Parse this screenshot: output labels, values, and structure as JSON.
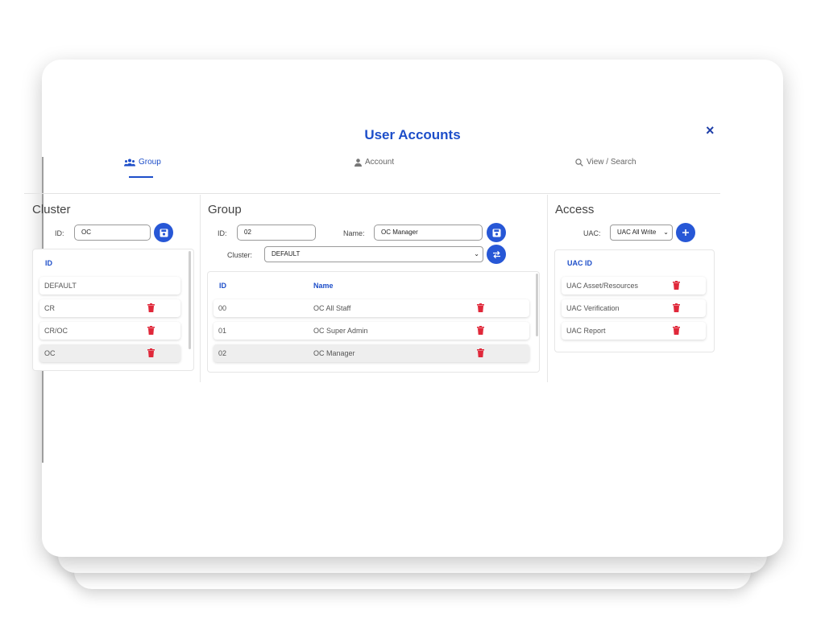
{
  "dialog": {
    "title": "User Accounts",
    "close_symbol": "×"
  },
  "tabs": [
    {
      "label": "Group",
      "icon": "users-icon",
      "active": true
    },
    {
      "label": "Account",
      "icon": "user-icon",
      "active": false
    },
    {
      "label": "View / Search",
      "icon": "search-icon",
      "active": false
    }
  ],
  "cluster": {
    "title": "Cluster",
    "id_label": "ID:",
    "id_value": "OC",
    "header": "ID",
    "rows": [
      "DEFAULT",
      "CR",
      "CR/OC",
      "OC"
    ]
  },
  "group": {
    "title": "Group",
    "id_label": "ID:",
    "id_value": "02",
    "name_label": "Name:",
    "name_value": "OC Manager",
    "cluster_label": "Cluster:",
    "cluster_value": "DEFAULT",
    "headers": {
      "id": "ID",
      "name": "Name"
    },
    "rows": [
      {
        "id": "00",
        "name": "OC All Staff"
      },
      {
        "id": "01",
        "name": "OC Super Admin"
      },
      {
        "id": "02",
        "name": "OC Manager"
      }
    ]
  },
  "access": {
    "title": "Access",
    "uac_label": "UAC:",
    "uac_value": "UAC All Write",
    "header": "UAC ID",
    "rows": [
      "UAC Asset/Resources",
      "UAC Verification",
      "UAC Report"
    ]
  },
  "colors": {
    "accent": "#1d4ec9",
    "button": "#2757d6",
    "delete": "#e0283a"
  }
}
